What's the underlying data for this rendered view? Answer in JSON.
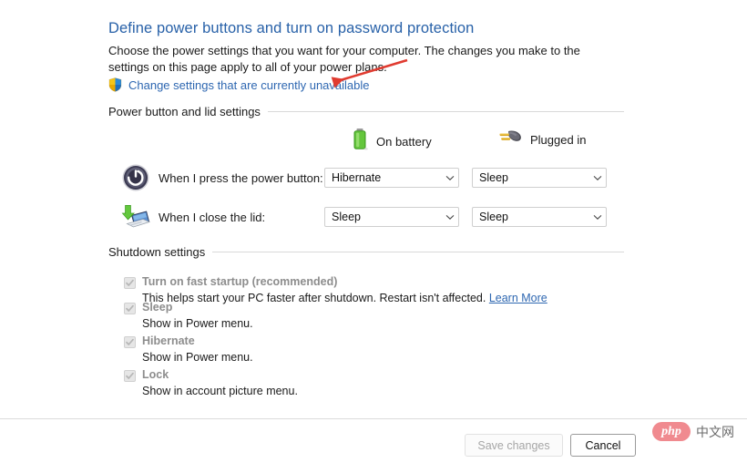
{
  "page": {
    "title": "Define power buttons and turn on password protection",
    "intro": "Choose the power settings that you want for your computer. The changes you make to the settings on this page apply to all of your power plans.",
    "uac_link": "Change settings that are currently unavailable",
    "uac_icon": "shield-icon"
  },
  "sections": {
    "power_buttons": {
      "heading": "Power button and lid settings",
      "columns": [
        {
          "label": "On battery",
          "icon": "battery-icon"
        },
        {
          "label": "Plugged in",
          "icon": "power-plug-icon"
        }
      ],
      "rows": [
        {
          "icon": "power-button-icon",
          "label": "When I press the power button:",
          "on_battery": "Hibernate",
          "plugged_in": "Sleep"
        },
        {
          "icon": "laptop-lid-icon",
          "label": "When I close the lid:",
          "on_battery": "Sleep",
          "plugged_in": "Sleep"
        }
      ]
    },
    "shutdown": {
      "heading": "Shutdown settings",
      "items": [
        {
          "label": "Turn on fast startup (recommended)",
          "checked": true,
          "disabled": true,
          "description": "This helps start your PC faster after shutdown. Restart isn't affected.",
          "link": "Learn More"
        },
        {
          "label": "Sleep",
          "checked": true,
          "disabled": true,
          "description": "Show in Power menu.",
          "link": ""
        },
        {
          "label": "Hibernate",
          "checked": true,
          "disabled": true,
          "description": "Show in Power menu.",
          "link": ""
        },
        {
          "label": "Lock",
          "checked": true,
          "disabled": true,
          "description": "Show in account picture menu.",
          "link": ""
        }
      ]
    }
  },
  "footer": {
    "save_label": "Save changes",
    "save_enabled": false,
    "cancel_label": "Cancel"
  },
  "annotation": {
    "type": "arrow",
    "color": "#e03b30",
    "points_to": "Change settings that are currently unavailable"
  },
  "watermark": {
    "badge": "php",
    "text": "中文网",
    "badge_color": "#f08a8f"
  },
  "colors": {
    "title_blue": "#2861a8",
    "link_blue": "#2e67b1",
    "disabled_gray": "#8d8d8d",
    "rule_gray": "#d9d9d9"
  }
}
